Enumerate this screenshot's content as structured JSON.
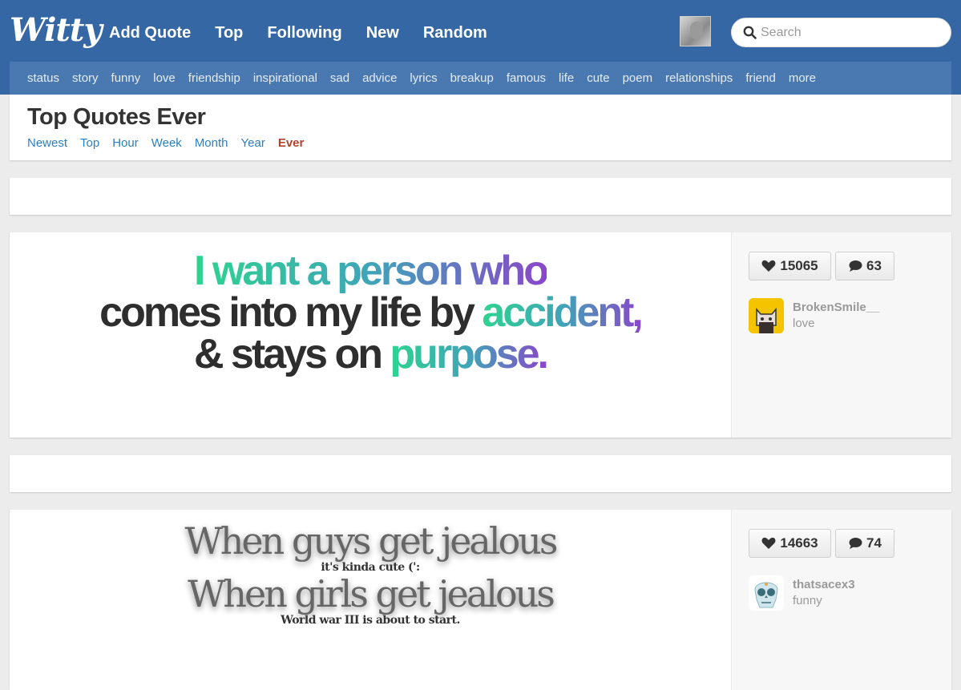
{
  "header": {
    "logo": "Witty",
    "nav": [
      "Add Quote",
      "Top",
      "Following",
      "New",
      "Random"
    ],
    "search_placeholder": "Search"
  },
  "tags": [
    "status",
    "story",
    "funny",
    "love",
    "friendship",
    "inspirational",
    "sad",
    "advice",
    "lyrics",
    "breakup",
    "famous",
    "life",
    "cute",
    "poem",
    "relationships",
    "friend",
    "more"
  ],
  "page": {
    "title": "Top Quotes Ever",
    "sorts": [
      "Newest",
      "Top",
      "Hour",
      "Week",
      "Month",
      "Year",
      "Ever"
    ],
    "active_sort": "Ever"
  },
  "quotes": [
    {
      "lines": [
        [
          {
            "t": "I want a person who",
            "style": "gradient"
          }
        ],
        [
          {
            "t": "comes into my life by ",
            "style": "dark"
          },
          {
            "t": "accident,",
            "style": "gradient"
          }
        ],
        [
          {
            "t": "& stays on ",
            "style": "dark"
          },
          {
            "t": "purpose.",
            "style": "gradient"
          }
        ]
      ],
      "likes": "15065",
      "comments": "63",
      "user": "BrokenSmile__",
      "category": "love",
      "avatar": "cat-avatar",
      "accent": "#f5c400"
    },
    {
      "lines": [
        {
          "t": "When guys get jealous",
          "size": "big"
        },
        {
          "t": "it's kinda cute (':",
          "size": "small"
        },
        {
          "t": "When girls get jealous",
          "size": "big"
        },
        {
          "t": "World war III is about to start.",
          "size": "small"
        }
      ],
      "likes": "14663",
      "comments": "74",
      "user": "thatsacex3",
      "category": "funny",
      "avatar": "skull-avatar"
    }
  ],
  "colors": {
    "header": "#3567a4",
    "tagbar": "#4a78b0",
    "link": "#2a7fc1",
    "active_sort": "#b0442a",
    "gradient": [
      "#2ed48f",
      "#3fa5b8",
      "#8a46c9"
    ]
  }
}
